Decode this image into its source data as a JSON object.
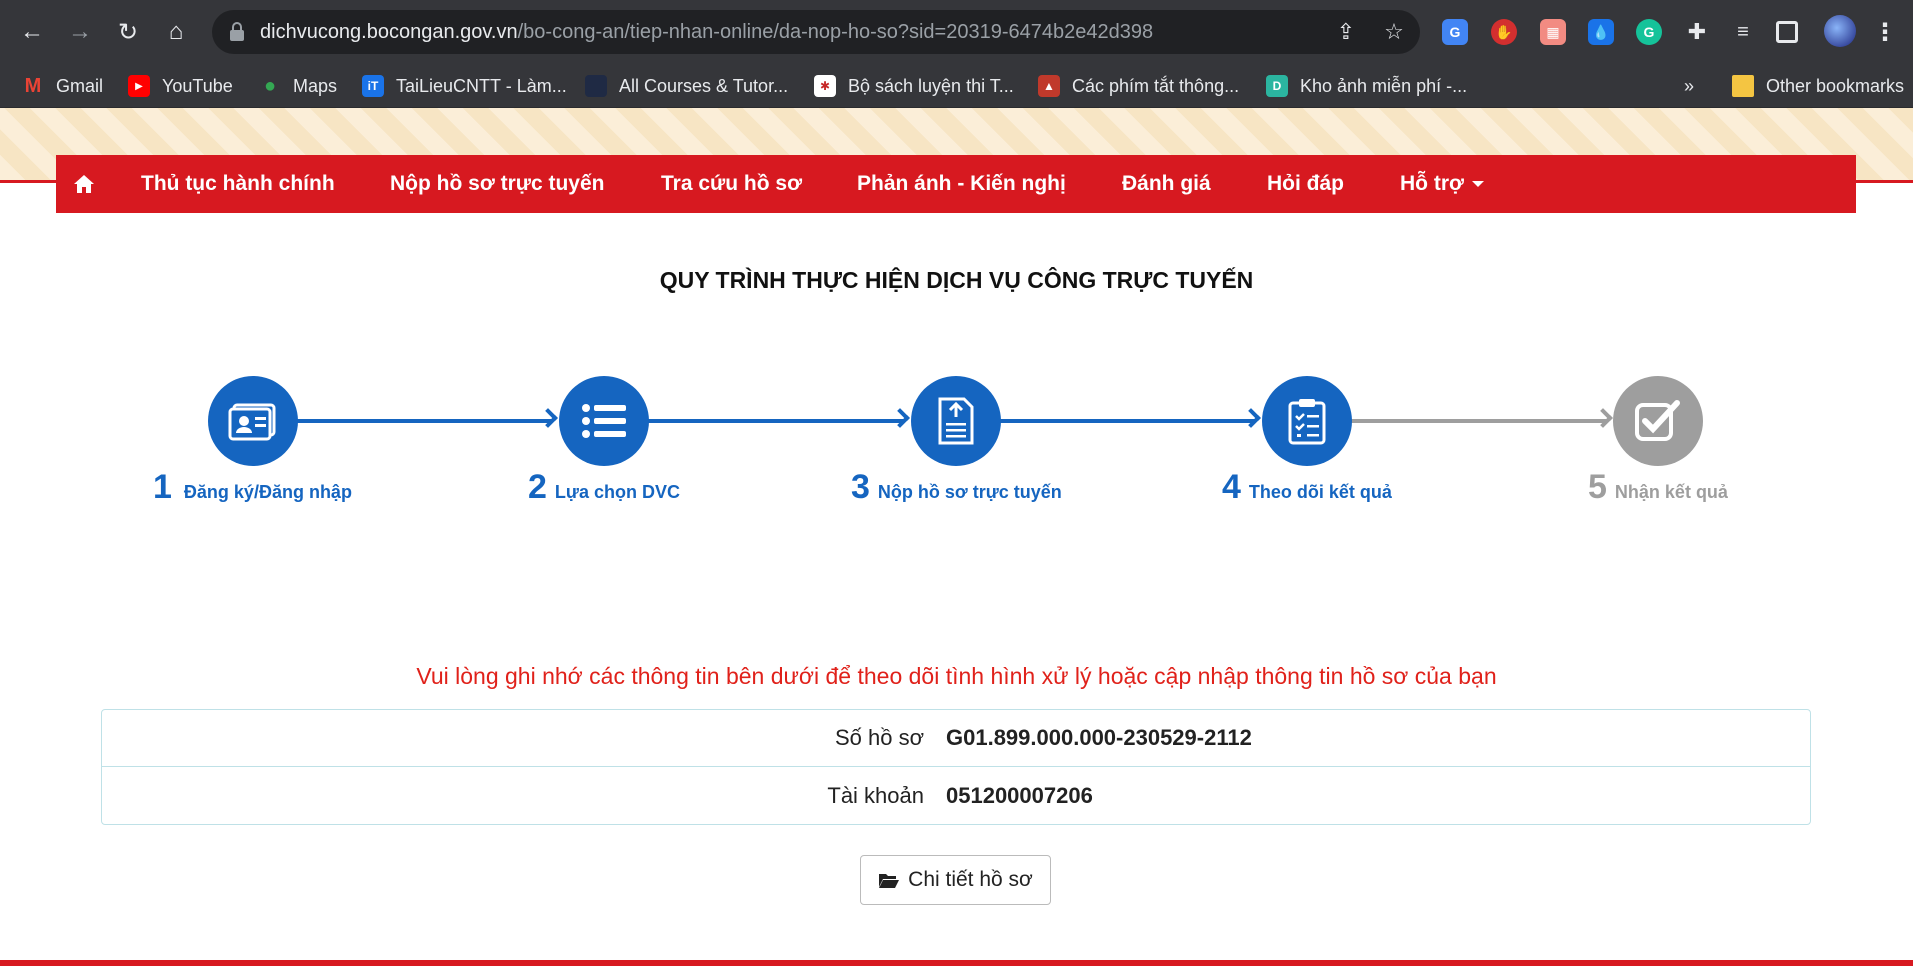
{
  "browser": {
    "url_host": "dichvucong.bocongan.gov.vn",
    "url_path": "/bo-cong-an/tiep-nhan-online/da-nop-ho-so?sid=20319-6474b2e42d398",
    "bookmarks": [
      {
        "label": "Gmail",
        "icon": "gmail-icon",
        "color": "#ea4335",
        "glyph": "M"
      },
      {
        "label": "YouTube",
        "icon": "youtube-icon",
        "color": "#ff0000",
        "glyph": "▶"
      },
      {
        "label": "Maps",
        "icon": "maps-icon",
        "color": "#34a853",
        "glyph": "●"
      },
      {
        "label": "TaiLieuCNTT - Làm...",
        "icon": "tailieucntt-icon",
        "color": "#1a73e8",
        "glyph": "iT"
      },
      {
        "label": "All Courses & Tutor...",
        "icon": "courses-icon",
        "color": "#1f2a44",
        "glyph": ""
      },
      {
        "label": "Bộ sách luyện thi T...",
        "icon": "book-icon",
        "color": "#ffffff",
        "glyph": "✱"
      },
      {
        "label": "Các phím tắt thông...",
        "icon": "shortcut-icon",
        "color": "#c0392b",
        "glyph": "▲"
      },
      {
        "label": "Kho ảnh miễn phí -...",
        "icon": "photo-icon",
        "color": "#2bb5a0",
        "glyph": "D"
      }
    ],
    "overflow_label": "»",
    "other_bookmarks": "Other bookmarks"
  },
  "nav": {
    "items": [
      "Thủ tục hành chính",
      "Nộp hồ sơ trực tuyến",
      "Tra cứu hồ sơ",
      "Phản ánh - Kiến nghị",
      "Đánh giá",
      "Hỏi đáp",
      "Hỗ trợ"
    ]
  },
  "process_title": "QUY TRÌNH THỰC HIỆN DỊCH VỤ CÔNG TRỰC TUYẾN",
  "steps": [
    {
      "num": "1",
      "label": "Đăng ký/Đăng nhập",
      "icon": "id-card-icon",
      "active": true
    },
    {
      "num": "2",
      "label": "Lựa chọn DVC",
      "icon": "list-icon",
      "active": true
    },
    {
      "num": "3",
      "label": "Nộp hồ sơ trực tuyến",
      "icon": "upload-document-icon",
      "active": true
    },
    {
      "num": "4",
      "label": "Theo dõi kết quả",
      "icon": "clipboard-checklist-icon",
      "active": true
    },
    {
      "num": "5",
      "label": "Nhận kết quả",
      "icon": "checkbox-icon",
      "active": false
    }
  ],
  "colors": {
    "active": "#1565c0",
    "inactive": "#9e9e9e",
    "brand_red": "#d71920",
    "notice_red": "#e0211a"
  },
  "notice": "Vui lòng ghi nhớ các thông tin bên dưới để theo dõi tình hình xử lý hoặc cập nhập thông tin hồ sơ của bạn",
  "info": [
    {
      "label": "Số hồ sơ",
      "value": "G01.899.000.000-230529-2112"
    },
    {
      "label": "Tài khoản",
      "value": "051200007206"
    }
  ],
  "detail_button": "Chi tiết hồ sơ"
}
